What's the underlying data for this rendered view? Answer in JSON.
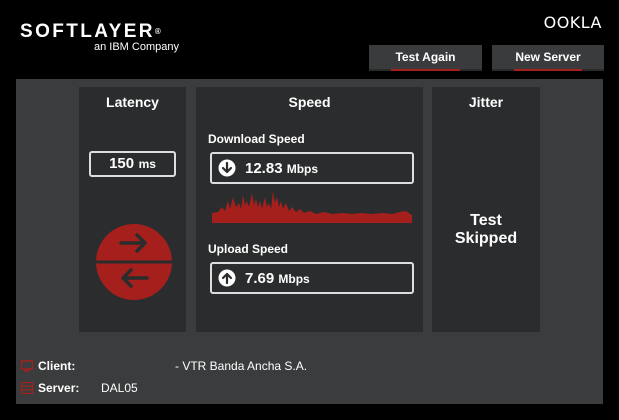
{
  "brand": {
    "name": "SOFTLAYER",
    "registered": "®",
    "subtitle": "an IBM Company"
  },
  "logo_right": "OOKLA",
  "header": {
    "test_again_label": "Test Again",
    "new_server_label": "New Server"
  },
  "latency": {
    "title": "Latency",
    "value": "150",
    "unit": "ms"
  },
  "speed": {
    "title": "Speed",
    "download_label": "Download Speed",
    "download_value": "12.83",
    "download_unit": "Mbps",
    "upload_label": "Upload Speed",
    "upload_value": "7.69",
    "upload_unit": "Mbps"
  },
  "jitter": {
    "title": "Jitter",
    "status_line1": "Test",
    "status_line2": "Skipped"
  },
  "info": {
    "client_label": "Client:",
    "client_value": "- VTR Banda Ancha S.A.",
    "server_label": "Server:",
    "server_value": "DAL05"
  },
  "colors": {
    "accent": "#a5201c",
    "panel_bg": "#3b3c3d",
    "column_bg": "#2b2c2d"
  },
  "icons": {
    "latency_gauge": "latency-arrows-icon",
    "download_arrow": "arrow-down-circle-icon",
    "upload_arrow": "arrow-up-circle-icon",
    "client": "monitor-icon",
    "server": "server-icon"
  }
}
